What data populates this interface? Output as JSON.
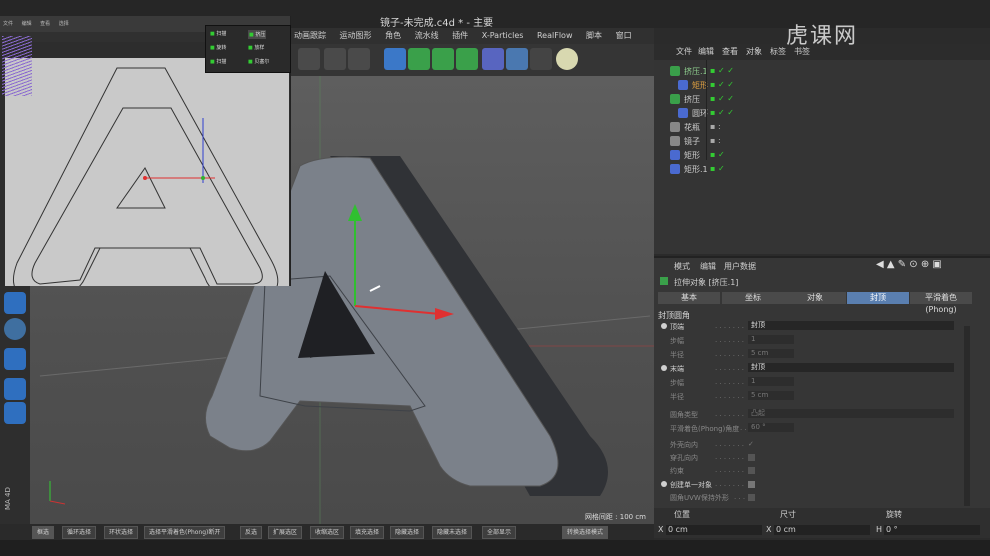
{
  "window": {
    "title": "镜子-未完成.c4d * - 主要"
  },
  "menubar": {
    "items": [
      "动画跟踪",
      "运动图形",
      "角色",
      "流水线",
      "插件",
      "X-Particles",
      "RealFlow",
      "脚本",
      "窗口",
      "帮助"
    ]
  },
  "inset": {
    "menu": [
      "文件",
      "编辑",
      "查看",
      "选择"
    ],
    "popup": {
      "items": [
        "扫描",
        "挤压",
        "旋转",
        "放样",
        "扫描",
        "贝塞尔"
      ]
    }
  },
  "object_manager": {
    "menu": [
      "文件",
      "编辑",
      "查看",
      "对象",
      "标签",
      "书签"
    ],
    "objects": [
      {
        "name": "挤压.1",
        "color": "#8fd08f"
      },
      {
        "name": "矩形",
        "color": "#e0a040"
      },
      {
        "name": "挤压",
        "color": "#8fd08f"
      },
      {
        "name": "圆环",
        "color": "#ffffff"
      },
      {
        "name": "花瓶",
        "color": "#ffffff"
      },
      {
        "name": "镜子",
        "color": "#ffffff"
      },
      {
        "name": "矩形",
        "color": "#ffffff"
      },
      {
        "name": "矩形.1",
        "color": "#ffffff"
      }
    ]
  },
  "attribute_manager": {
    "menu": [
      "模式",
      "编辑",
      "用户数据"
    ],
    "object_title": "拉伸对象 [挤压.1]",
    "tabs": [
      "基本",
      "坐标",
      "对象",
      "封顶",
      "平滑着色(Phong)"
    ],
    "active_tab": "封顶",
    "section": "封顶圆角",
    "params": [
      {
        "label": "顶端",
        "value": "封顶",
        "radio": true
      },
      {
        "label": "步幅",
        "value": "1",
        "dim": true
      },
      {
        "label": "半径",
        "value": "5 cm",
        "dim": true
      },
      {
        "label": "末端",
        "value": "封顶",
        "radio": true
      },
      {
        "label": "步幅",
        "value": "1",
        "dim": true
      },
      {
        "label": "半径",
        "value": "5 cm",
        "dim": true
      },
      {
        "label": "圆角类型",
        "value": "凸起",
        "dim": true
      },
      {
        "label": "平滑着色(Phong)角度",
        "value": "60 °",
        "dim": true
      },
      {
        "label": "外壳向内",
        "value": "✓",
        "dim": true
      },
      {
        "label": "穿孔向内",
        "value": "",
        "dim": true
      },
      {
        "label": "约束",
        "value": "",
        "dim": true
      },
      {
        "label": "创建单一对象",
        "value": "",
        "radio": true
      },
      {
        "label": "圆角UVW保持外形",
        "value": "",
        "dim": true
      }
    ]
  },
  "coordinates": {
    "headers": [
      "位置",
      "尺寸",
      "旋转"
    ],
    "x_pos": "0 cm",
    "x_size": "0 cm",
    "h_rot": "0 °",
    "axis_x": "X",
    "axis_x2": "X",
    "axis_h": "H"
  },
  "viewport": {
    "grid_label": "网格间距 : 100 cm"
  },
  "statusbar": {
    "items": [
      "框选",
      "循环选择",
      "环状选择",
      "选择平滑着色(Phong)断开",
      "反选",
      "扩展选区",
      "收缩选区",
      "填充选择",
      "隐藏选择",
      "隐藏未选择",
      "全部显示",
      "转换选择模式"
    ]
  },
  "watermark": "虎课网",
  "side_label": "MA 4D",
  "colors": {
    "accent": "#5a7fb0",
    "viewport": "#555555",
    "panel": "#343434"
  }
}
